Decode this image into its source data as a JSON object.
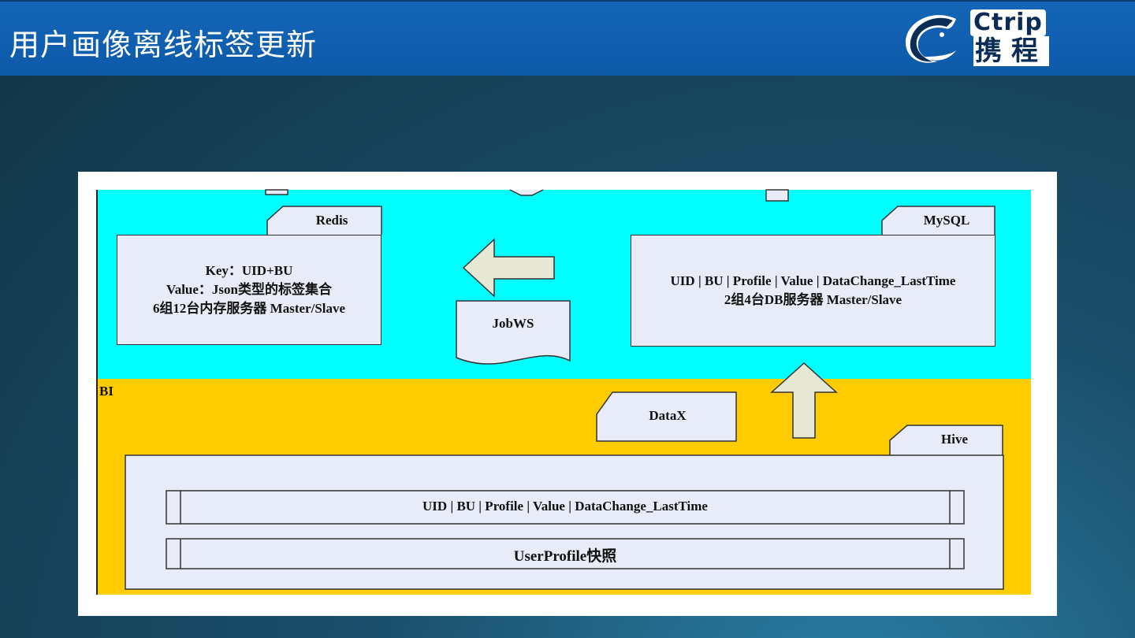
{
  "header": {
    "title": "用户画像离线标签更新"
  },
  "logo": {
    "en": "Ctrip",
    "cn": "携程"
  },
  "diagram": {
    "redis": {
      "tab": "Redis",
      "lines": [
        "Key：UID+BU",
        "Value：Json类型的标签集合",
        "6组12台内存服务器 Master/Slave"
      ]
    },
    "mysql": {
      "tab": "MySQL",
      "lines": [
        "UID | BU | Profile | Value | DataChange_LastTime",
        "2组4台DB服务器 Master/Slave"
      ]
    },
    "jobws": "JobWS",
    "bi_label": "BI",
    "datax": "DataX",
    "hive": {
      "tab": "Hive",
      "row1": "UID | BU | Profile | Value | DataChange_LastTime",
      "row2": "UserProfile快照"
    }
  },
  "colors": {
    "header": "#0d5aa8",
    "zone_top": "#00ffff",
    "zone_bi": "#ffcc00",
    "box_fill": "#e8ecf8",
    "arrow_fill": "#e6e8d4"
  }
}
